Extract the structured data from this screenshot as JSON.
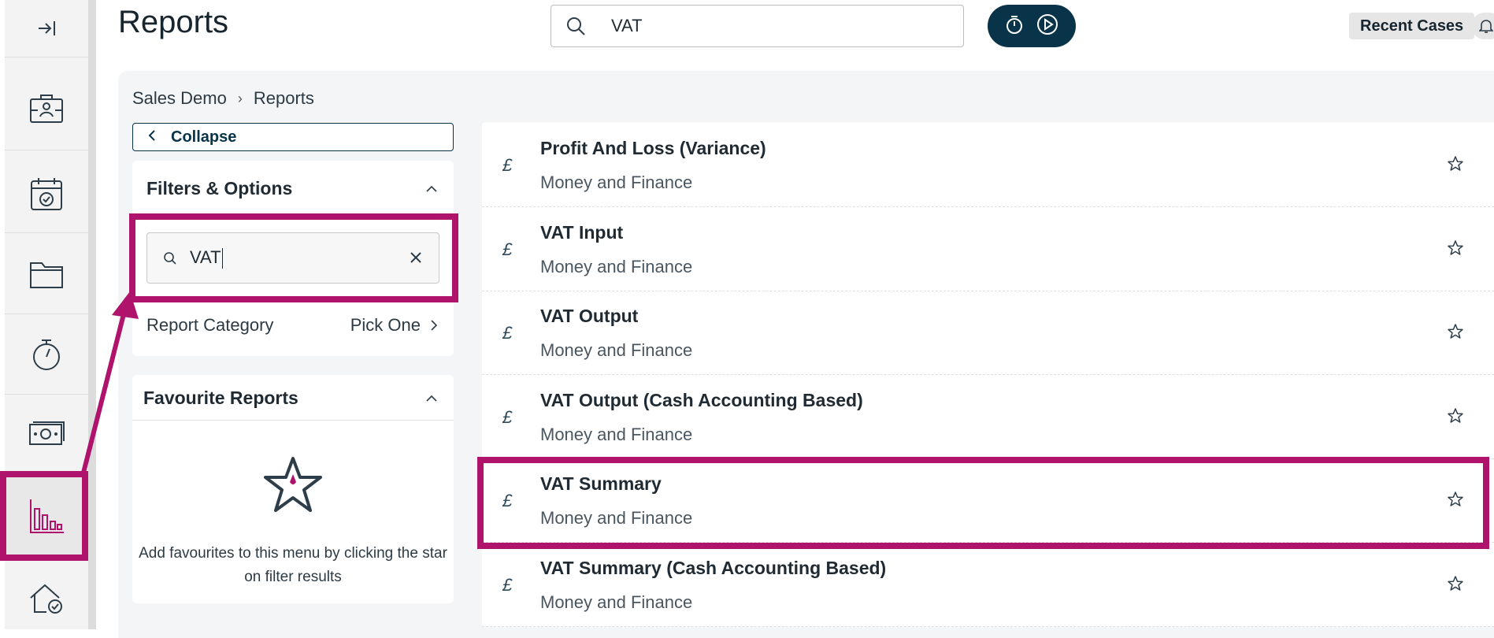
{
  "header": {
    "title": "Reports",
    "search_value": "VAT",
    "recent_cases_label": "Recent Cases"
  },
  "breadcrumb": {
    "items": [
      "Sales Demo",
      "Reports"
    ],
    "separator": "›"
  },
  "sidebar": {
    "collapse_label": "Collapse",
    "filters": {
      "title": "Filters & Options",
      "search_value": "VAT",
      "category_label": "Report Category",
      "category_value": "Pick One"
    },
    "favourites": {
      "title": "Favourite Reports",
      "empty_text": "Add favourites to this menu by clicking the star on filter results"
    }
  },
  "nav_rail": {
    "icons": [
      "expand-icon",
      "briefcase-person-icon",
      "calendar-check-icon",
      "folder-icon",
      "stopwatch-icon",
      "banknote-icon",
      "bar-chart-icon",
      "house-check-icon"
    ],
    "active": "bar-chart-icon"
  },
  "results": [
    {
      "currency": "£",
      "title": "Profit And Loss (Variance)",
      "category": "Money and Finance"
    },
    {
      "currency": "£",
      "title": "VAT Input",
      "category": "Money and Finance"
    },
    {
      "currency": "£",
      "title": "VAT Output",
      "category": "Money and Finance"
    },
    {
      "currency": "£",
      "title": "VAT Output (Cash Accounting Based)",
      "category": "Money and Finance"
    },
    {
      "currency": "£",
      "title": "VAT Summary",
      "category": "Money and Finance"
    },
    {
      "currency": "£",
      "title": "VAT Summary (Cash Accounting Based)",
      "category": "Money and Finance"
    }
  ],
  "colors": {
    "accent": "#b0136c",
    "brand_dark": "#083349",
    "rail_bg": "#f3f3f3",
    "content_bg": "#f4f5f7"
  }
}
